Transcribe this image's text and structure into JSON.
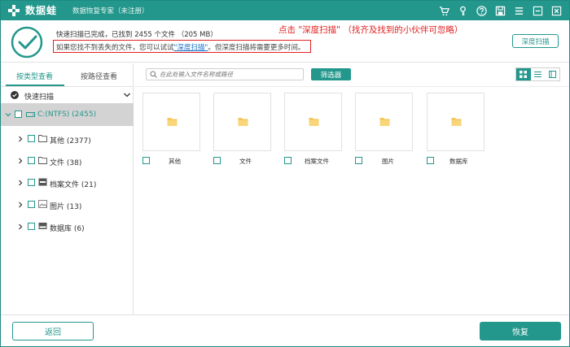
{
  "app": {
    "name": "数据蛙",
    "subtitle": "数据恢复专家（未注册）"
  },
  "titlebar_icons": [
    "cart-icon",
    "key-icon",
    "help-icon",
    "save-icon",
    "menu-icon",
    "minimize-icon",
    "close-icon"
  ],
  "status": {
    "done_text": "快速扫描已完成，已找到  2455  个文件 （205 MB）",
    "hint_prefix": "如果您找不到丢失的文件，您可以试试",
    "hint_link": "\"深度扫描\"",
    "hint_suffix": "。但深度扫描将需要更多时间。",
    "annotation": "点击  \"深度扫描\"    （找齐及找到的小伙伴可忽略）",
    "deep_scan_button": "深度扫描"
  },
  "sidebar": {
    "tabs": [
      {
        "label": "按类型查看",
        "active": true
      },
      {
        "label": "按路径查看",
        "active": false
      }
    ],
    "quick_scan_label": "快速扫描",
    "drive_label": "C:(NTFS) (2455)",
    "items": [
      {
        "label": "其他 (2377)",
        "icon": "folder-icon"
      },
      {
        "label": "文件 (38)",
        "icon": "folder-icon"
      },
      {
        "label": "档案文件 (21)",
        "icon": "archive-icon"
      },
      {
        "label": "图片 (13)",
        "icon": "image-icon"
      },
      {
        "label": "数据库 (6)",
        "icon": "database-icon"
      }
    ]
  },
  "main": {
    "search_placeholder": "在此处输入文件名称或路径",
    "filter_button": "筛选器",
    "view_modes": [
      "grid-view-icon",
      "list-view-icon",
      "detail-view-icon"
    ],
    "cards": [
      {
        "label": "其他"
      },
      {
        "label": "文件"
      },
      {
        "label": "档案文件"
      },
      {
        "label": "图片"
      },
      {
        "label": "数据库"
      }
    ]
  },
  "footer": {
    "back_button": "返回",
    "recover_button": "恢复"
  },
  "colors": {
    "accent": "#23978c",
    "annotation": "#e02020",
    "folder": "#f5c65a",
    "selected_row": "#d3d3d3"
  }
}
